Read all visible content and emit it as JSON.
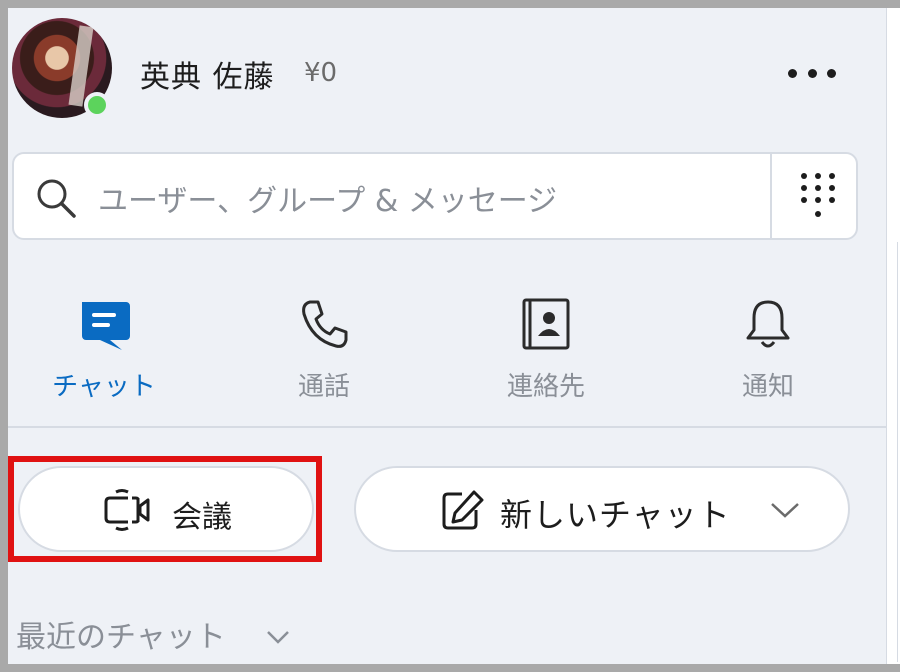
{
  "header": {
    "user_name": "英典 佐藤",
    "balance": "¥0",
    "presence_color": "#5cd35c",
    "more_icon": "more-horizontal-icon"
  },
  "search": {
    "placeholder": "ユーザー、グループ & メッセージ",
    "search_icon": "search-icon",
    "dialpad_icon": "dialpad-icon"
  },
  "tabs": [
    {
      "label": "チャット",
      "icon": "chat-icon",
      "active": true
    },
    {
      "label": "通話",
      "icon": "phone-icon",
      "active": false
    },
    {
      "label": "連絡先",
      "icon": "contacts-icon",
      "active": false
    },
    {
      "label": "通知",
      "icon": "bell-icon",
      "active": false
    }
  ],
  "actions": {
    "meet_label": "会議",
    "meet_icon": "video-camera-icon",
    "new_chat_label": "新しいチャット",
    "new_chat_icon": "compose-icon",
    "new_chat_dropdown_icon": "chevron-down-icon"
  },
  "recent": {
    "label": "最近のチャット"
  },
  "colors": {
    "accent": "#0a6bc2",
    "highlight_border": "#e01212",
    "panel_bg": "#eef1f6"
  }
}
